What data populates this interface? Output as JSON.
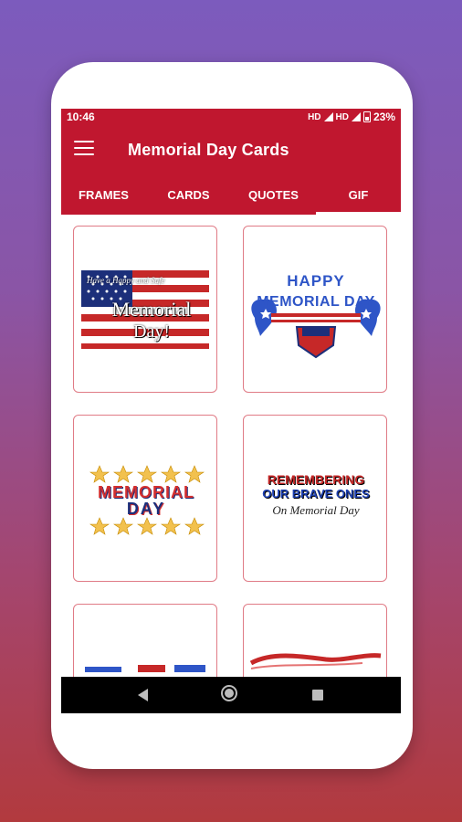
{
  "status": {
    "time": "10:46",
    "net1": "HD",
    "net2": "HD",
    "battery": "23%"
  },
  "appbar": {
    "title": "Memorial Day Cards",
    "menu_icon": "hamburger-menu-icon"
  },
  "tabs": [
    {
      "label": "FRAMES",
      "active": false
    },
    {
      "label": "CARDS",
      "active": false
    },
    {
      "label": "QUOTES",
      "active": false
    },
    {
      "label": "GIF",
      "active": true
    }
  ],
  "cards": [
    {
      "line1": "Have a Happy and Safe",
      "line2": "Memorial",
      "line3": "Day!"
    },
    {
      "line1": "HAPPY",
      "line2": "MEMORIAL DAY"
    },
    {
      "line1": "MEMORIAL",
      "line2": "DAY"
    },
    {
      "line1": "REMEMBERING",
      "line2": "OUR BRAVE ONES",
      "line3": "On Memorial Day"
    },
    {
      "line1": ""
    },
    {
      "line1": ""
    }
  ],
  "navbar": {
    "back_icon": "back-icon",
    "home_icon": "home-icon",
    "recents_icon": "recents-icon"
  },
  "colors": {
    "primary": "#c0172f",
    "card_border": "#e07b86"
  }
}
